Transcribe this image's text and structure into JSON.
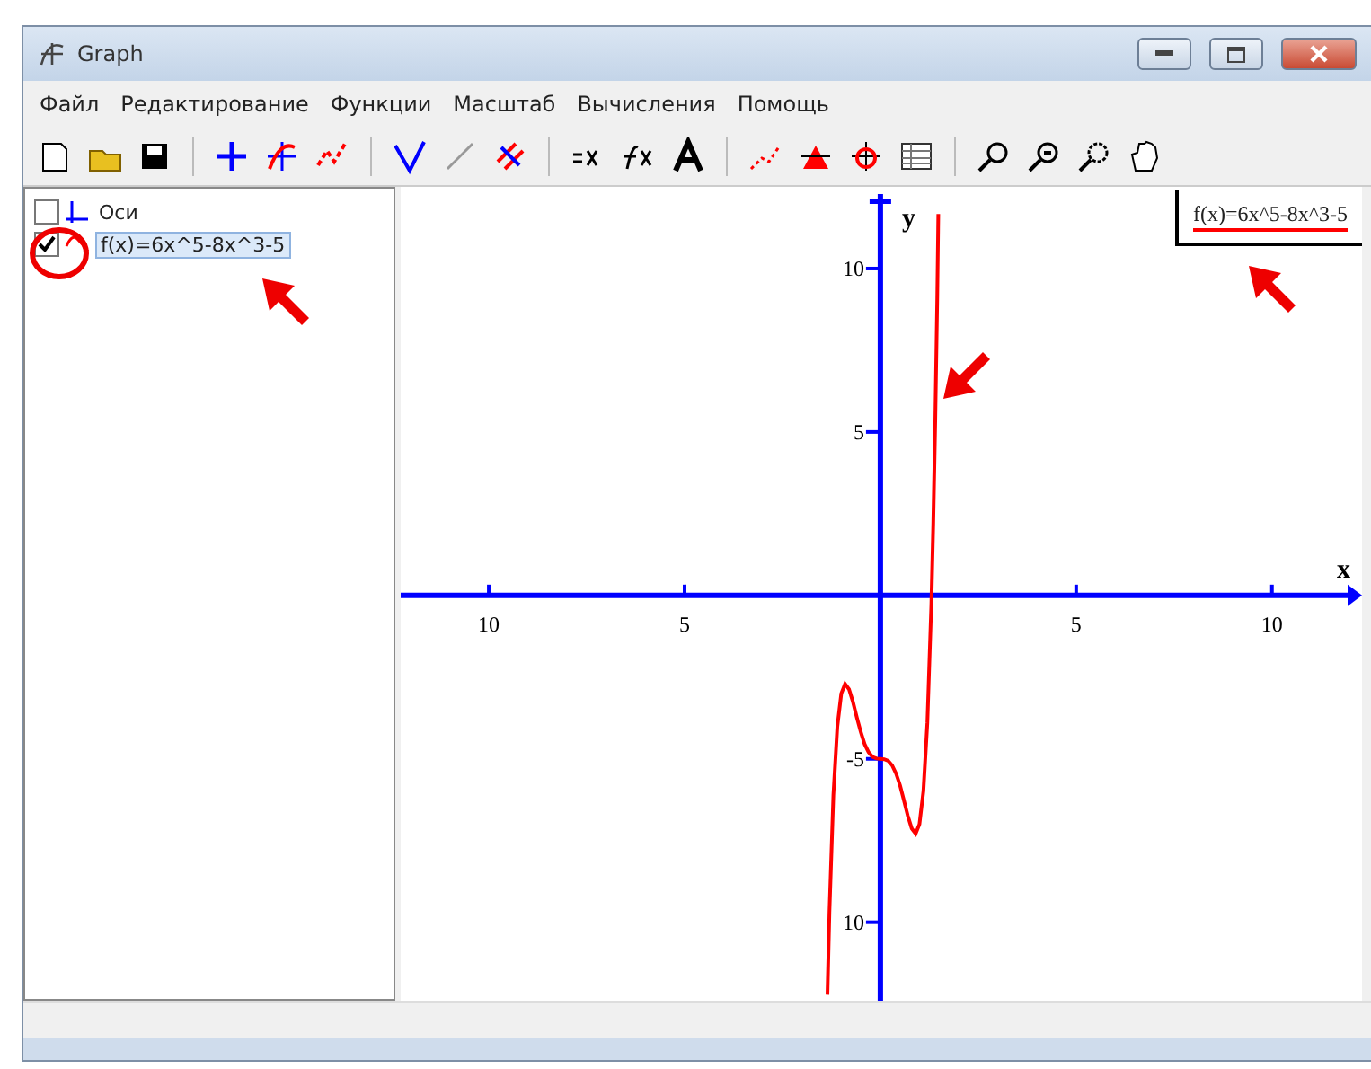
{
  "window": {
    "title": "Graph"
  },
  "menu": [
    "Файл",
    "Редактирование",
    "Функции",
    "Масштаб",
    "Вычисления",
    "Помощь"
  ],
  "tree": [
    {
      "kind": "axes",
      "label": "Оси",
      "checked": false,
      "selected": false
    },
    {
      "kind": "function",
      "label": "f(x)=6x^5-8x^3-5",
      "checked": true,
      "selected": true
    }
  ],
  "graph": {
    "xlabel": "x",
    "ylabel": "y",
    "chart_data": {
      "type": "line",
      "xlim": [
        -12.25,
        12.3
      ],
      "ylim": [
        -12.4,
        12.5
      ],
      "xticks": [
        {
          "value": -10,
          "label": "10"
        },
        {
          "value": -5,
          "label": "5"
        },
        {
          "value": 5,
          "label": "5"
        },
        {
          "value": 10,
          "label": "10"
        }
      ],
      "yticks": [
        {
          "value": 10,
          "label": "10"
        },
        {
          "value": 5,
          "label": "5"
        },
        {
          "value": -5,
          "label": "-5"
        },
        {
          "value": -10,
          "label": "10"
        }
      ],
      "x": [
        -1.35,
        -1.3,
        -1.2,
        -1.1,
        -1.0,
        -0.9,
        -0.8,
        -0.7,
        -0.6,
        -0.5,
        -0.4,
        -0.3,
        -0.2,
        -0.1,
        0,
        0.1,
        0.2,
        0.3,
        0.4,
        0.5,
        0.6,
        0.7,
        0.8,
        0.9,
        1.0,
        1.1,
        1.2,
        1.3,
        1.35,
        1.4,
        1.45,
        1.48
      ],
      "series": [
        {
          "name": "f(x)=6x^5-8x^3-5",
          "color": "#ff0000",
          "values": [
            -12.22,
            -9.7,
            -6.11,
            -4.02,
            -3,
            -2.71,
            -2.87,
            -3.26,
            -3.74,
            -4.19,
            -4.55,
            -4.8,
            -4.94,
            -4.99,
            -5,
            -5.01,
            -5.06,
            -5.2,
            -5.45,
            -5.81,
            -6.26,
            -6.74,
            -7.13,
            -7.29,
            -7,
            -5.99,
            -3.89,
            -0.3,
            2.22,
            5.32,
            9.07,
            11.67
          ]
        }
      ]
    }
  }
}
